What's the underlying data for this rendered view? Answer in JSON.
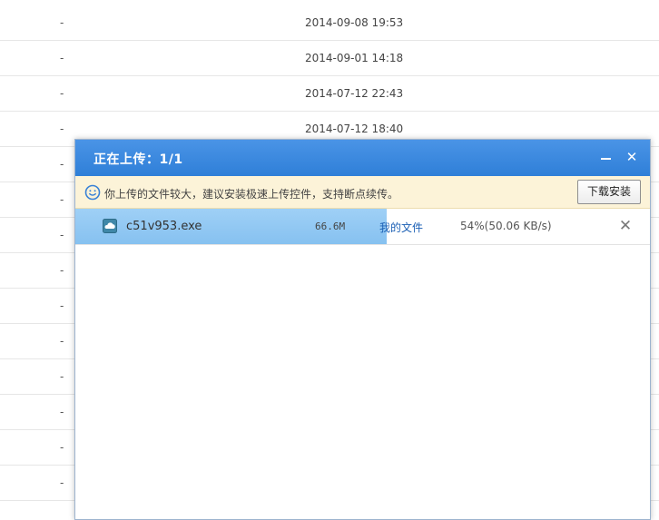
{
  "file_list": {
    "rows": [
      {
        "size": "-",
        "date": "2014-09-08 19:53"
      },
      {
        "size": "-",
        "date": "2014-09-01 14:18"
      },
      {
        "size": "-",
        "date": "2014-07-12 22:43"
      },
      {
        "size": "-",
        "date": "2014-07-12 18:40"
      },
      {
        "size": "-",
        "date": ""
      },
      {
        "size": "-",
        "date": ""
      },
      {
        "size": "-",
        "date": ""
      },
      {
        "size": "-",
        "date": ""
      },
      {
        "size": "-",
        "date": ""
      },
      {
        "size": "-",
        "date": ""
      },
      {
        "size": "-",
        "date": ""
      },
      {
        "size": "-",
        "date": ""
      },
      {
        "size": "-",
        "date": ""
      },
      {
        "size": "-",
        "date": ""
      }
    ]
  },
  "dialog": {
    "title": "正在上传：1/1",
    "minimize_icon": "minimize-icon",
    "close_icon": "close-icon",
    "colors": {
      "header": "#3d8ae0",
      "notice_bg": "#fcf3d8",
      "progress": "#94c9f3",
      "link": "#1a5fb4"
    }
  },
  "notice": {
    "icon": "smile-icon",
    "text": "你上传的文件较大，建议安装极速上传控件，支持断点续传。",
    "install_label": "下载安装"
  },
  "upload": {
    "file_icon": "cloud-file-icon",
    "file_name": "c51v953.exe",
    "file_size": "66.6M",
    "destination": "我的文件",
    "progress_fraction": 0.54,
    "progress_label": "54%(50.06 KB/s)",
    "cancel_icon": "close-x-icon"
  }
}
